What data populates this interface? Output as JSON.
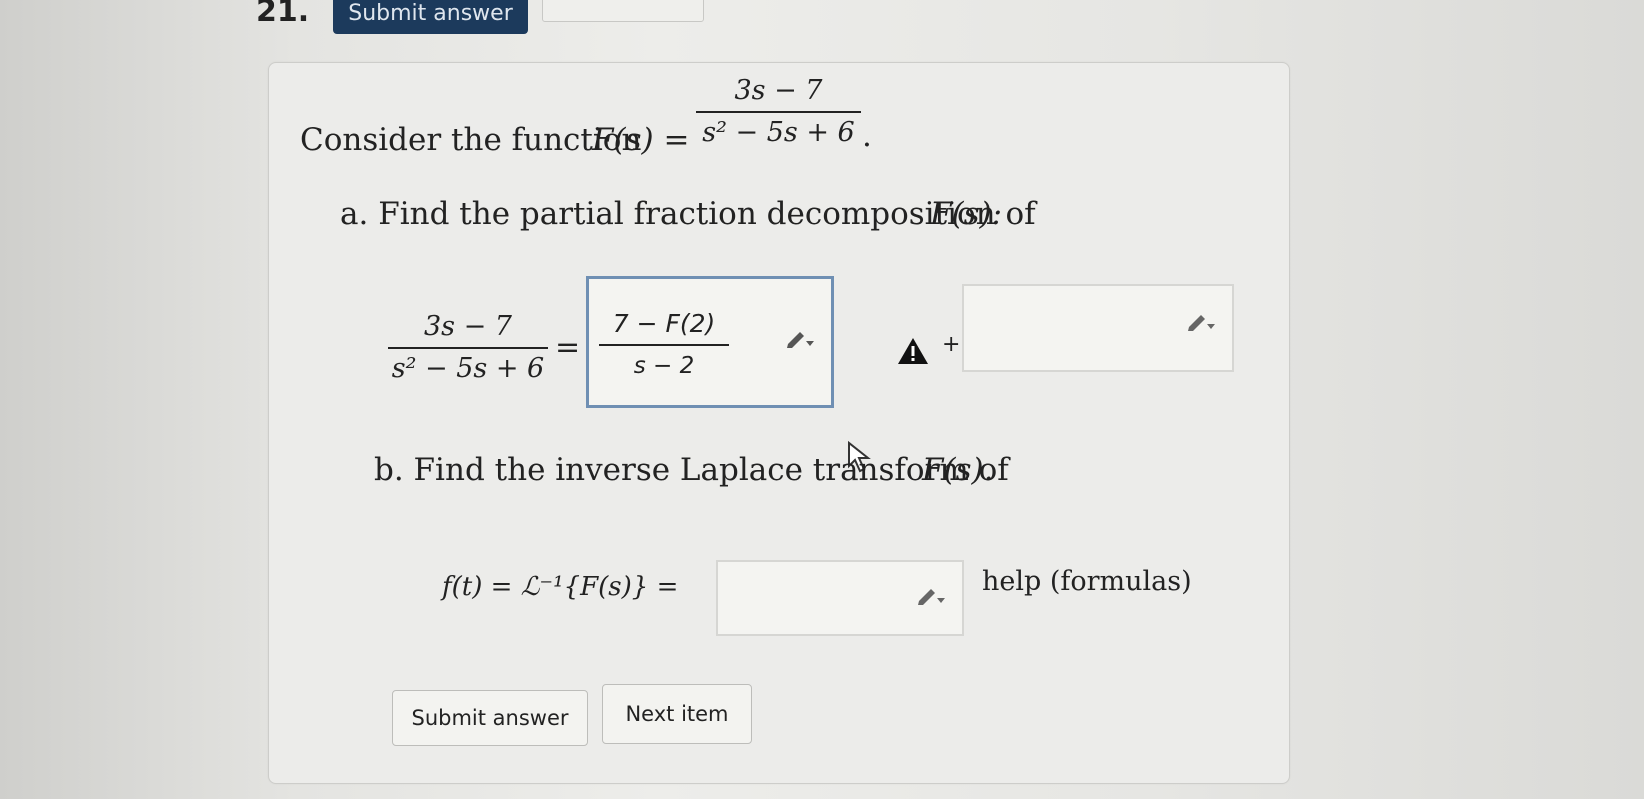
{
  "header": {
    "question_number": "21.",
    "submit_top_label": "Submit answer"
  },
  "question": {
    "intro_text": "Consider the function ",
    "function_lhs": "F(s) =",
    "numerator": "3s − 7",
    "denominator": "s² − 5s + 6",
    "period": "."
  },
  "part_a": {
    "prompt": "a. Find the partial fraction decomposition of ",
    "prompt_math": "F(s):",
    "lhs_numerator": "3s − 7",
    "lhs_denominator": "s² − 5s + 6",
    "equals": "=",
    "answer1_numerator": "7 − F(2)",
    "answer1_denominator": "s − 2",
    "plus": "+",
    "answer2_value": ""
  },
  "part_b": {
    "prompt": "b. Find the inverse Laplace transform of ",
    "prompt_math": "F(s).",
    "lhs": "f(t) = ℒ⁻¹{F(s)} =",
    "answer_value": "",
    "help_link": "help (formulas)"
  },
  "buttons": {
    "submit_label": "Submit answer",
    "next_label": "Next item"
  },
  "icons": {
    "pencil": "pencil-dropdown-icon",
    "warning": "warning-icon",
    "cursor": "mouse-pointer-icon"
  },
  "colors": {
    "active_border": "#6f8fb3",
    "header_button": "#1c3a5c"
  }
}
